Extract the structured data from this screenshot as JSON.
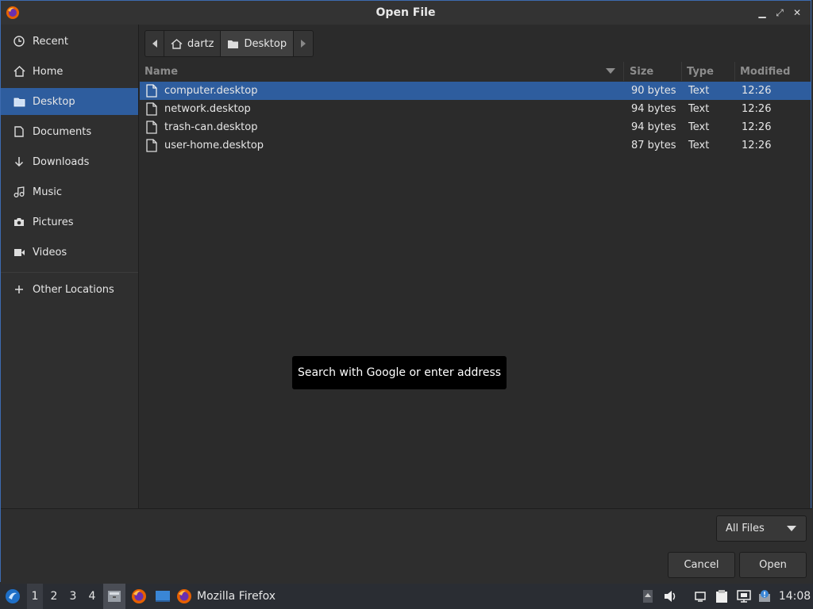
{
  "window": {
    "title": "Open File"
  },
  "sidebar": {
    "items": [
      {
        "label": "Recent",
        "icon": "clock-icon"
      },
      {
        "label": "Home",
        "icon": "home-icon"
      },
      {
        "label": "Desktop",
        "icon": "folder-icon"
      },
      {
        "label": "Documents",
        "icon": "document-icon"
      },
      {
        "label": "Downloads",
        "icon": "download-icon"
      },
      {
        "label": "Music",
        "icon": "music-icon"
      },
      {
        "label": "Pictures",
        "icon": "camera-icon"
      },
      {
        "label": "Videos",
        "icon": "video-icon"
      },
      {
        "label": "Other Locations",
        "icon": "plus-icon"
      }
    ],
    "active": "Desktop"
  },
  "pathbar": {
    "segments": [
      "dartz",
      "Desktop"
    ]
  },
  "columns": {
    "name": "Name",
    "size": "Size",
    "type": "Type",
    "modified": "Modified"
  },
  "files": [
    {
      "name": "computer.desktop",
      "size": "90 bytes",
      "type": "Text",
      "modified": "12:26"
    },
    {
      "name": "network.desktop",
      "size": "94 bytes",
      "type": "Text",
      "modified": "12:26"
    },
    {
      "name": "trash-can.desktop",
      "size": "94 bytes",
      "type": "Text",
      "modified": "12:26"
    },
    {
      "name": "user-home.desktop",
      "size": "87 bytes",
      "type": "Text",
      "modified": "12:26"
    }
  ],
  "tooltip": {
    "text": "Search with Google or enter address"
  },
  "filter": {
    "selected": "All Files"
  },
  "buttons": {
    "cancel": "Cancel",
    "open": "Open"
  },
  "taskbar": {
    "workspaces": [
      "1",
      "2",
      "3",
      "4"
    ],
    "active_workspace": "1",
    "task_label": "Mozilla Firefox",
    "clock": "14:08"
  },
  "colors": {
    "accent": "#2e5d9e",
    "border": "#3d6bb0"
  }
}
